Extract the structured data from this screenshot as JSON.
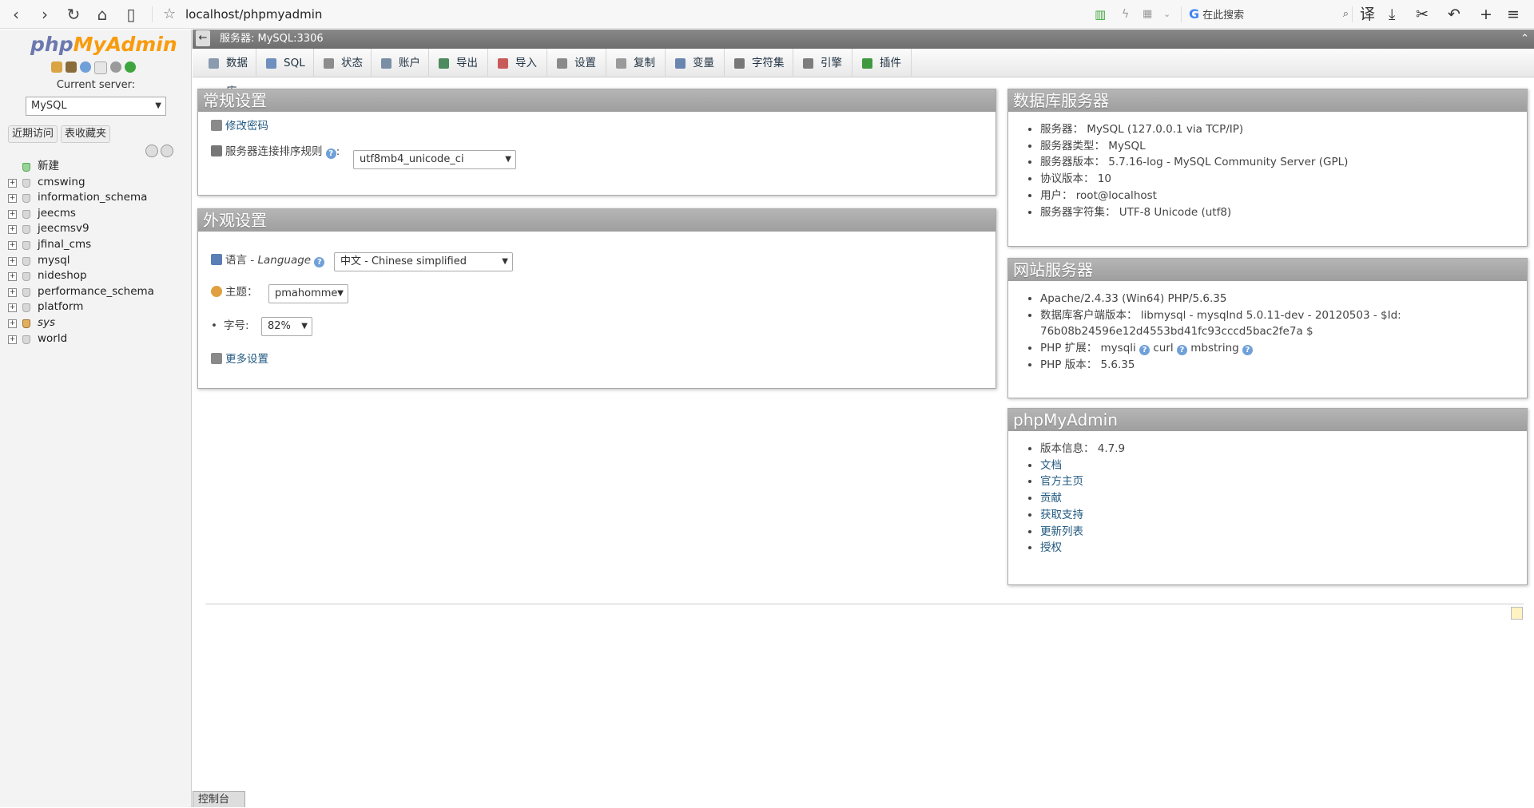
{
  "browser": {
    "url": "localhost/phpmyadmin",
    "search_placeholder": "在此搜索"
  },
  "sidebar": {
    "logo_php": "php",
    "logo_my": "MyAdmin",
    "current_server_label": "Current server:",
    "server_value": "MySQL",
    "recent_tab": "近期访问",
    "favorites_tab": "表收藏夹",
    "databases": [
      {
        "name": "新建",
        "kind": "new"
      },
      {
        "name": "cmswing"
      },
      {
        "name": "information_schema"
      },
      {
        "name": "jeecms"
      },
      {
        "name": "jeecmsv9"
      },
      {
        "name": "jfinal_cms"
      },
      {
        "name": "mysql"
      },
      {
        "name": "nideshop"
      },
      {
        "name": "performance_schema"
      },
      {
        "name": "platform"
      },
      {
        "name": "sys",
        "italic": true
      },
      {
        "name": "world"
      }
    ]
  },
  "topbar": {
    "breadcrumb": "服务器: MySQL:3306"
  },
  "menu": [
    {
      "label": "数据库",
      "color": "#8a9bb0"
    },
    {
      "label": "SQL",
      "color": "#6f8fbf"
    },
    {
      "label": "状态",
      "color": "#8c8c8c"
    },
    {
      "label": "账户",
      "color": "#7a8fa6"
    },
    {
      "label": "导出",
      "color": "#4d8a5e"
    },
    {
      "label": "导入",
      "color": "#c95a5a"
    },
    {
      "label": "设置",
      "color": "#8a8a8a"
    },
    {
      "label": "复制",
      "color": "#9a9a9a"
    },
    {
      "label": "变量",
      "color": "#6a86b0"
    },
    {
      "label": "字符集",
      "color": "#777777"
    },
    {
      "label": "引擎",
      "color": "#7d7d7d"
    },
    {
      "label": "插件",
      "color": "#3f9a3f"
    }
  ],
  "general": {
    "title": "常规设置",
    "change_password": "修改密码",
    "collation_label": "服务器连接排序规则",
    "collation_value": "utf8mb4_unicode_ci"
  },
  "appearance": {
    "title": "外观设置",
    "language_label": "语言 - ",
    "language_en": "Language",
    "language_value": "中文 - Chinese simplified",
    "theme_label": "主题：",
    "theme_value": "pmahomme",
    "font_label": "字号:",
    "font_value": "82%",
    "more_settings": "更多设置"
  },
  "db_server": {
    "title": "数据库服务器",
    "items": [
      "服务器： MySQL (127.0.0.1 via TCP/IP)",
      "服务器类型： MySQL",
      "服务器版本： 5.7.16-log - MySQL Community Server (GPL)",
      "协议版本： 10",
      "用户： root@localhost",
      "服务器字符集： UTF-8 Unicode (utf8)"
    ]
  },
  "web_server": {
    "title": "网站服务器",
    "apache": "Apache/2.4.33 (Win64) PHP/5.6.35",
    "client_line1": "数据库客户端版本： libmysql - mysqlnd 5.0.11-dev - 20120503 - $Id:",
    "client_line2": "76b08b24596e12d4553bd41fc93cccd5bac2fe7a $",
    "php_ext_label": "PHP 扩展：",
    "php_ext": [
      "mysqli",
      "curl",
      "mbstring"
    ],
    "php_version": "PHP 版本： 5.6.35"
  },
  "pma": {
    "title": "phpMyAdmin",
    "version": "版本信息： 4.7.9",
    "links": [
      "文档",
      "官方主页",
      "贡献",
      "获取支持",
      "更新列表",
      "授权"
    ]
  },
  "console": {
    "label": "控制台"
  }
}
